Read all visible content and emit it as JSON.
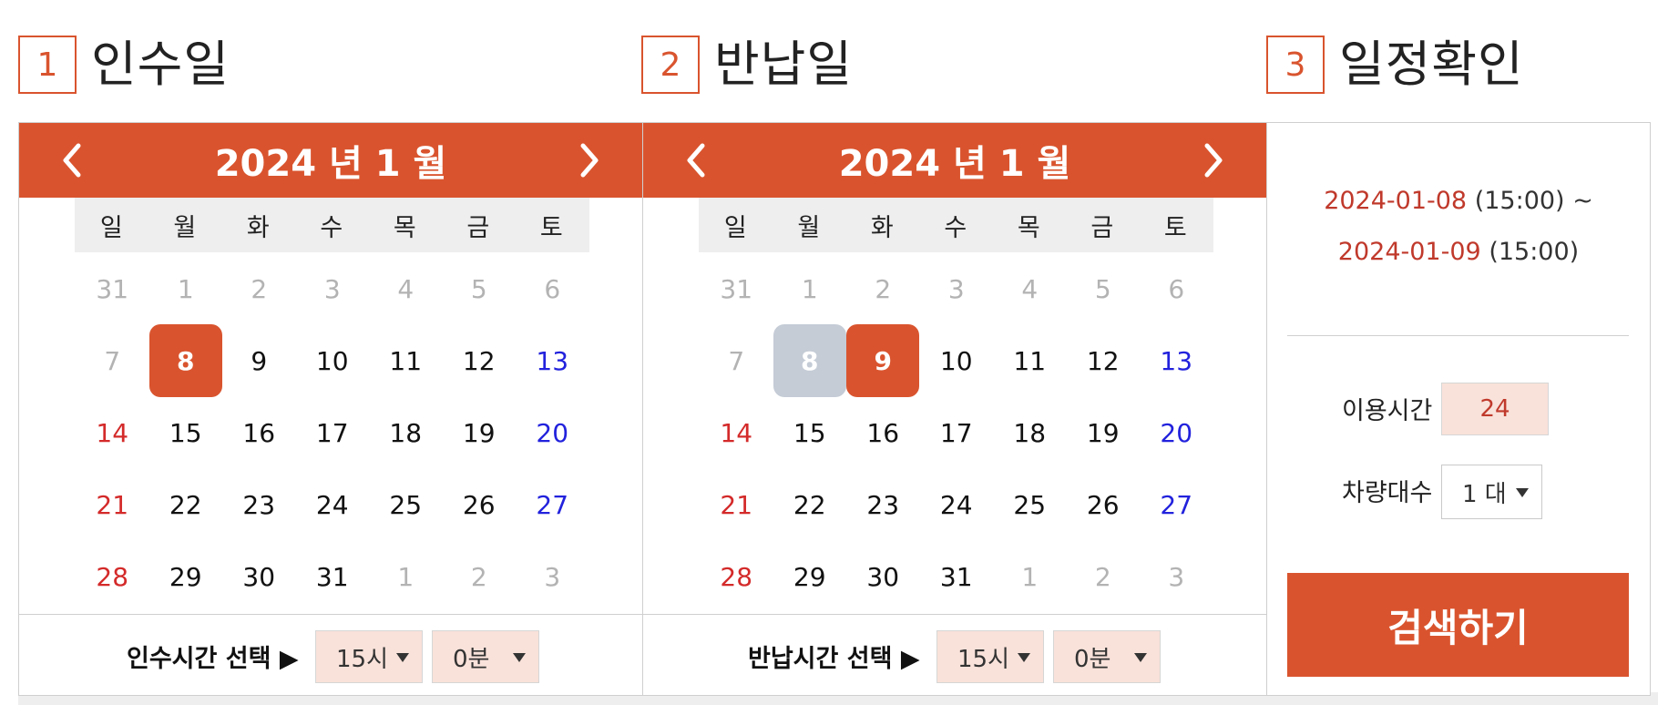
{
  "steps": [
    {
      "number": "1",
      "title": "인수일"
    },
    {
      "number": "2",
      "title": "반납일"
    },
    {
      "number": "3",
      "title": "일정확인"
    }
  ],
  "weekdays": [
    "일",
    "월",
    "화",
    "수",
    "목",
    "금",
    "토"
  ],
  "pickup_calendar": {
    "title": "2024 년 1 월",
    "prev_icon": "chevron-left-icon",
    "next_icon": "chevron-right-icon",
    "weeks": [
      [
        {
          "d": "31",
          "t": "other"
        },
        {
          "d": "1",
          "t": "other"
        },
        {
          "d": "2",
          "t": "other"
        },
        {
          "d": "3",
          "t": "other"
        },
        {
          "d": "4",
          "t": "other"
        },
        {
          "d": "5",
          "t": "other"
        },
        {
          "d": "6",
          "t": "other"
        }
      ],
      [
        {
          "d": "7",
          "t": "other"
        },
        {
          "d": "8",
          "t": "sel"
        },
        {
          "d": "9",
          "t": "normal"
        },
        {
          "d": "10",
          "t": "normal"
        },
        {
          "d": "11",
          "t": "normal"
        },
        {
          "d": "12",
          "t": "normal"
        },
        {
          "d": "13",
          "t": "sat"
        }
      ],
      [
        {
          "d": "14",
          "t": "sun"
        },
        {
          "d": "15",
          "t": "normal"
        },
        {
          "d": "16",
          "t": "normal"
        },
        {
          "d": "17",
          "t": "normal"
        },
        {
          "d": "18",
          "t": "normal"
        },
        {
          "d": "19",
          "t": "normal"
        },
        {
          "d": "20",
          "t": "sat"
        }
      ],
      [
        {
          "d": "21",
          "t": "sun"
        },
        {
          "d": "22",
          "t": "normal"
        },
        {
          "d": "23",
          "t": "normal"
        },
        {
          "d": "24",
          "t": "normal"
        },
        {
          "d": "25",
          "t": "normal"
        },
        {
          "d": "26",
          "t": "normal"
        },
        {
          "d": "27",
          "t": "sat"
        }
      ],
      [
        {
          "d": "28",
          "t": "sun"
        },
        {
          "d": "29",
          "t": "normal"
        },
        {
          "d": "30",
          "t": "normal"
        },
        {
          "d": "31",
          "t": "normal"
        },
        {
          "d": "1",
          "t": "other"
        },
        {
          "d": "2",
          "t": "other"
        },
        {
          "d": "3",
          "t": "other"
        }
      ]
    ],
    "time_label": "인수시간 선택 ▶",
    "hour_value": "15시",
    "minute_value": "0분"
  },
  "return_calendar": {
    "title": "2024 년 1 월",
    "prev_icon": "chevron-left-icon",
    "next_icon": "chevron-right-icon",
    "weeks": [
      [
        {
          "d": "31",
          "t": "other"
        },
        {
          "d": "1",
          "t": "other"
        },
        {
          "d": "2",
          "t": "other"
        },
        {
          "d": "3",
          "t": "other"
        },
        {
          "d": "4",
          "t": "other"
        },
        {
          "d": "5",
          "t": "other"
        },
        {
          "d": "6",
          "t": "other"
        }
      ],
      [
        {
          "d": "7",
          "t": "other"
        },
        {
          "d": "8",
          "t": "range"
        },
        {
          "d": "9",
          "t": "sel"
        },
        {
          "d": "10",
          "t": "normal"
        },
        {
          "d": "11",
          "t": "normal"
        },
        {
          "d": "12",
          "t": "normal"
        },
        {
          "d": "13",
          "t": "sat"
        }
      ],
      [
        {
          "d": "14",
          "t": "sun"
        },
        {
          "d": "15",
          "t": "normal"
        },
        {
          "d": "16",
          "t": "normal"
        },
        {
          "d": "17",
          "t": "normal"
        },
        {
          "d": "18",
          "t": "normal"
        },
        {
          "d": "19",
          "t": "normal"
        },
        {
          "d": "20",
          "t": "sat"
        }
      ],
      [
        {
          "d": "21",
          "t": "sun"
        },
        {
          "d": "22",
          "t": "normal"
        },
        {
          "d": "23",
          "t": "normal"
        },
        {
          "d": "24",
          "t": "normal"
        },
        {
          "d": "25",
          "t": "normal"
        },
        {
          "d": "26",
          "t": "normal"
        },
        {
          "d": "27",
          "t": "sat"
        }
      ],
      [
        {
          "d": "28",
          "t": "sun"
        },
        {
          "d": "29",
          "t": "normal"
        },
        {
          "d": "30",
          "t": "normal"
        },
        {
          "d": "31",
          "t": "normal"
        },
        {
          "d": "1",
          "t": "other"
        },
        {
          "d": "2",
          "t": "other"
        },
        {
          "d": "3",
          "t": "other"
        }
      ]
    ],
    "time_label": "반납시간 선택 ▶",
    "hour_value": "15시",
    "minute_value": "0분"
  },
  "confirm": {
    "start_date": "2024-01-08",
    "start_time": "(15:00)",
    "tilde": "~",
    "end_date": "2024-01-09",
    "end_time": "(15:00)",
    "hours_label": "이용시간",
    "hours_value": "24",
    "count_label": "차량대수",
    "count_value": "1 대",
    "search_label": "검색하기"
  },
  "colors": {
    "accent": "#d9542e",
    "range": "#c5ccd6",
    "sunday": "#d42a2a",
    "saturday": "#2222dd",
    "muted": "#b3b3b3",
    "select_bg": "#f9e2da"
  }
}
